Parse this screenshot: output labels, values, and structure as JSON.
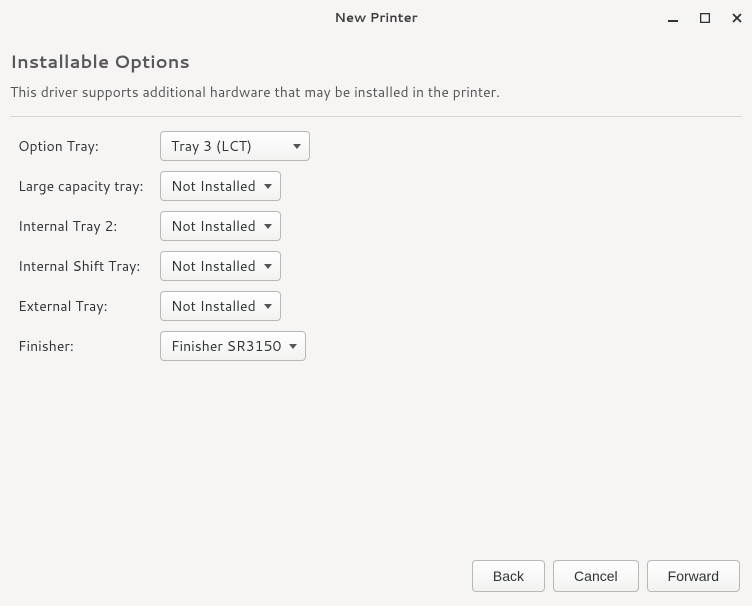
{
  "window": {
    "title": "New Printer"
  },
  "page": {
    "section_title": "Installable Options",
    "description": "This driver supports additional hardware that may be installed in the printer."
  },
  "options": [
    {
      "label": "Option Tray:",
      "value": "Tray 3 (LCT)",
      "wide": true
    },
    {
      "label": "Large capacity tray:",
      "value": "Not Installed",
      "wide": false
    },
    {
      "label": "Internal Tray 2:",
      "value": "Not Installed",
      "wide": false
    },
    {
      "label": "Internal Shift Tray:",
      "value": "Not Installed",
      "wide": false
    },
    {
      "label": "External Tray:",
      "value": "Not Installed",
      "wide": false
    },
    {
      "label": "Finisher:",
      "value": "Finisher SR3150",
      "wide": false
    }
  ],
  "footer": {
    "back": "Back",
    "cancel": "Cancel",
    "forward": "Forward"
  }
}
